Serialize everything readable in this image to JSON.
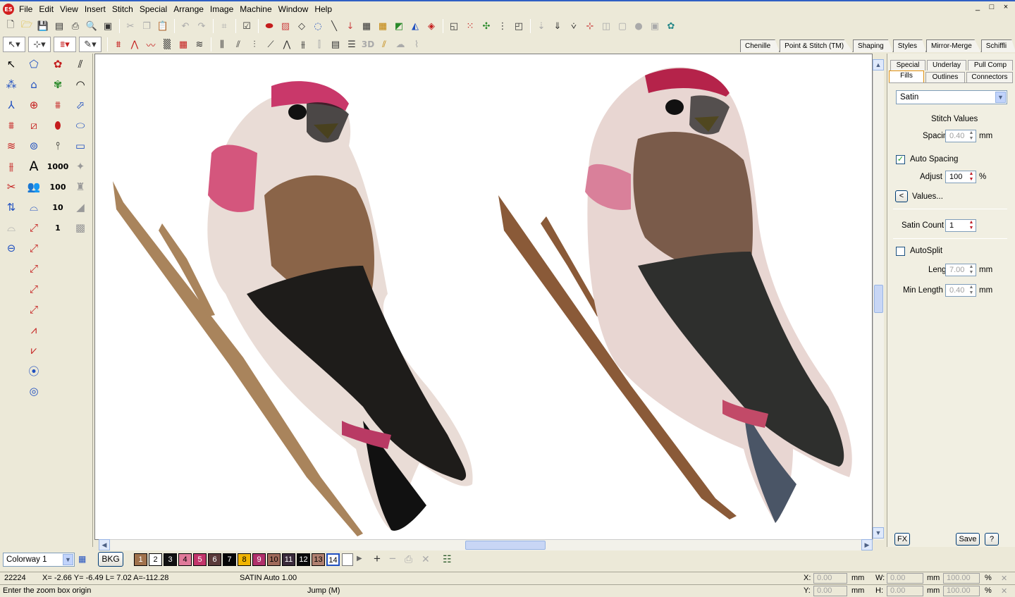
{
  "menu": {
    "app_icon": "ES",
    "items": [
      "File",
      "Edit",
      "View",
      "Insert",
      "Stitch",
      "Special",
      "Arrange",
      "Image",
      "Machine",
      "Window",
      "Help"
    ]
  },
  "window_controls": [
    "_",
    "□",
    "×"
  ],
  "toolbar2": {
    "threed_label": "3D"
  },
  "stitch_tabs": [
    "Chenille",
    "Point & Stitch (TM)",
    "Shaping",
    "Styles",
    "Mirror-Merge",
    "Schiffli"
  ],
  "palette": {
    "a_label": "A",
    "n1000": "1000",
    "n100": "100",
    "n10": "10",
    "n1": "1"
  },
  "panel": {
    "tabs_top": [
      "Special",
      "Underlay",
      "Pull Comp"
    ],
    "tabs_bottom": [
      "Fills",
      "Outlines",
      "Connectors"
    ],
    "fill_type": "Satin",
    "stitch_values_heading": "Stitch Values",
    "spacing_label": "Spacing",
    "spacing_value": "0.40",
    "spacing_unit": "mm",
    "auto_spacing_label": "Auto Spacing",
    "auto_spacing_checked": "✓",
    "adjust_label": "Adjust",
    "adjust_value": "100",
    "adjust_unit": "%",
    "values_button_arrow": "<",
    "values_label": "Values...",
    "satin_count_label": "Satin Count",
    "satin_count_value": "1",
    "autosplit_label": "AutoSplit",
    "length_label": "Length",
    "length_value": "7.00",
    "length_unit": "mm",
    "min_length_label": "Min Length",
    "min_length_value": "0.40",
    "min_length_unit": "mm",
    "fx_label": "FX",
    "save_label": "Save",
    "help_label": "?"
  },
  "colorbar": {
    "colorway": "Colorway 1",
    "bkg_label": "BKG",
    "swatches": [
      {
        "n": "1",
        "color": "#a0724c",
        "fg": "#ffffff"
      },
      {
        "n": "2",
        "color": "#ffffff",
        "fg": "#000000"
      },
      {
        "n": "3",
        "color": "#111111",
        "fg": "#ffffff"
      },
      {
        "n": "4",
        "color": "#e07a9a",
        "fg": "#000000"
      },
      {
        "n": "5",
        "color": "#c2356a",
        "fg": "#ffffff"
      },
      {
        "n": "6",
        "color": "#5a3a3a",
        "fg": "#ffffff"
      },
      {
        "n": "7",
        "color": "#050505",
        "fg": "#ffffff"
      },
      {
        "n": "8",
        "color": "#f0b400",
        "fg": "#000000"
      },
      {
        "n": "9",
        "color": "#b0306a",
        "fg": "#ffffff"
      },
      {
        "n": "10",
        "color": "#a06a5a",
        "fg": "#000000"
      },
      {
        "n": "11",
        "color": "#3a2a3a",
        "fg": "#ffffff"
      },
      {
        "n": "12",
        "color": "#0a0a0a",
        "fg": "#ffffff"
      },
      {
        "n": "13",
        "color": "#b08070",
        "fg": "#000000"
      },
      {
        "n": "14",
        "color": "#ffffff",
        "fg": "#000000"
      }
    ]
  },
  "status": {
    "stitch_count": "22224",
    "coords": "X=  -2.66 Y=  -6.49 L=    7.02 A=-112.28",
    "stitch_type": "SATIN Auto  1.00",
    "hint": "Enter the zoom box origin",
    "jump": "Jump (M)",
    "x_label": "X:",
    "x_value": "0.00",
    "y_label": "Y:",
    "y_value": "0.00",
    "w_label": "W:",
    "w_value": "0.00",
    "h_label": "H:",
    "h_value": "0.00",
    "mm": "mm",
    "pct_w": "100.00",
    "pct_h": "100.00",
    "pct": "%"
  }
}
